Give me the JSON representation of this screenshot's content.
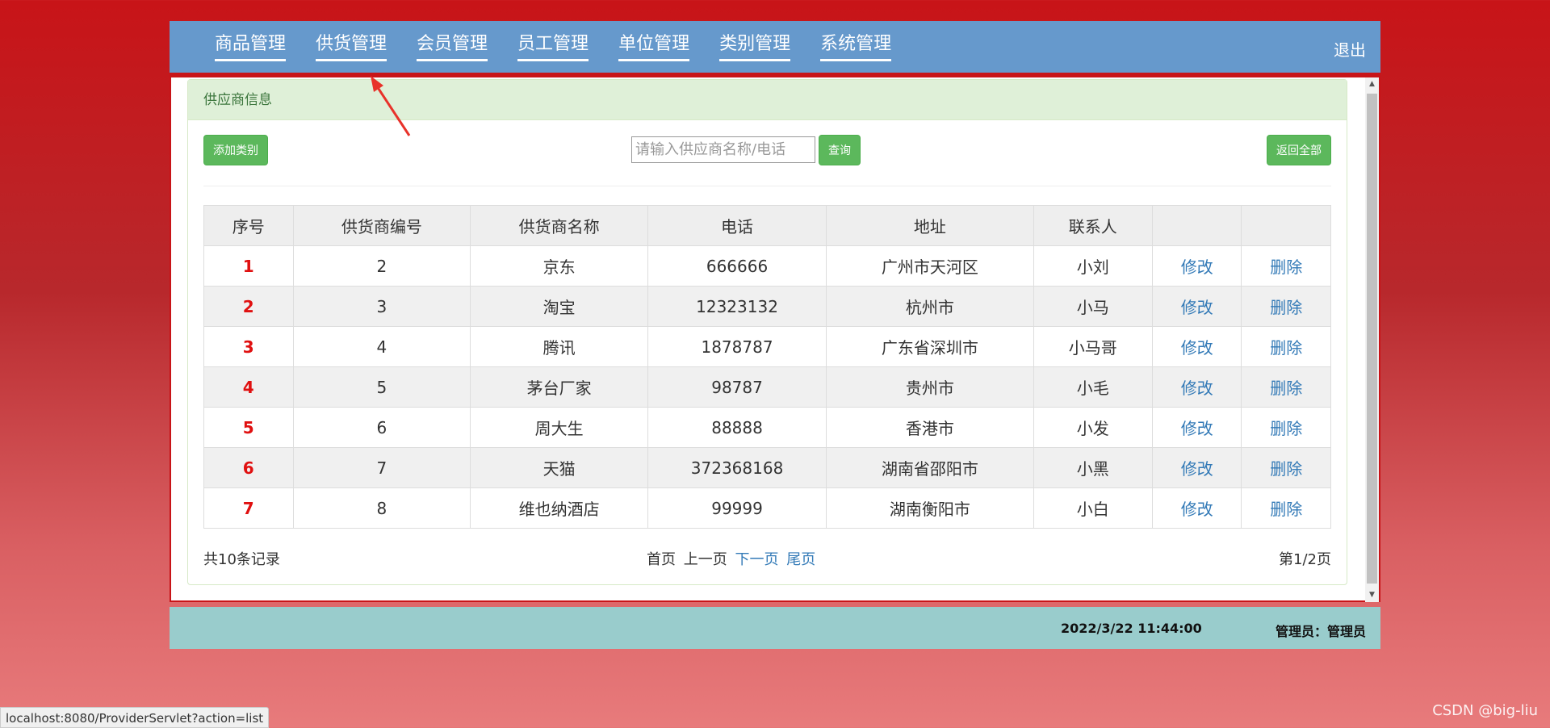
{
  "nav": {
    "items": [
      "商品管理",
      "供货管理",
      "会员管理",
      "员工管理",
      "单位管理",
      "类别管理",
      "系统管理"
    ],
    "logout": "退出"
  },
  "panel": {
    "title": "供应商信息",
    "add_button": "添加类别",
    "search_placeholder": "请输入供应商名称/电话",
    "query_button": "查询",
    "back_button": "返回全部"
  },
  "table": {
    "headers": [
      "序号",
      "供货商编号",
      "供货商名称",
      "电话",
      "地址",
      "联系人",
      "",
      ""
    ],
    "rows": [
      {
        "seq": "1",
        "id": "2",
        "name": "京东",
        "phone": "666666",
        "address": "广州市天河区",
        "contact": "小刘",
        "edit": "修改",
        "delete": "删除"
      },
      {
        "seq": "2",
        "id": "3",
        "name": "淘宝",
        "phone": "12323132",
        "address": "杭州市",
        "contact": "小马",
        "edit": "修改",
        "delete": "删除"
      },
      {
        "seq": "3",
        "id": "4",
        "name": "腾讯",
        "phone": "1878787",
        "address": "广东省深圳市",
        "contact": "小马哥",
        "edit": "修改",
        "delete": "删除"
      },
      {
        "seq": "4",
        "id": "5",
        "name": "茅台厂家",
        "phone": "98787",
        "address": "贵州市",
        "contact": "小毛",
        "edit": "修改",
        "delete": "删除"
      },
      {
        "seq": "5",
        "id": "6",
        "name": "周大生",
        "phone": "88888",
        "address": "香港市",
        "contact": "小发",
        "edit": "修改",
        "delete": "删除"
      },
      {
        "seq": "6",
        "id": "7",
        "name": "天猫",
        "phone": "372368168",
        "address": "湖南省邵阳市",
        "contact": "小黑",
        "edit": "修改",
        "delete": "删除"
      },
      {
        "seq": "7",
        "id": "8",
        "name": "维也纳酒店",
        "phone": "99999",
        "address": "湖南衡阳市",
        "contact": "小白",
        "edit": "修改",
        "delete": "删除"
      }
    ]
  },
  "pagination": {
    "total": "共10条记录",
    "first": "首页",
    "prev": "上一页",
    "next": "下一页",
    "last": "尾页",
    "page_info": "第1/2页"
  },
  "footer": {
    "datetime": "2022/3/22 11:44:00",
    "admin": "管理员：管理员"
  },
  "statusbar": "localhost:8080/ProviderServlet?action=list",
  "watermark": "CSDN @big-liu",
  "colors": {
    "nav_bg": "#6699cc",
    "accent_green": "#5cb85c",
    "link": "#337ab7",
    "seq_red": "#e01010"
  }
}
